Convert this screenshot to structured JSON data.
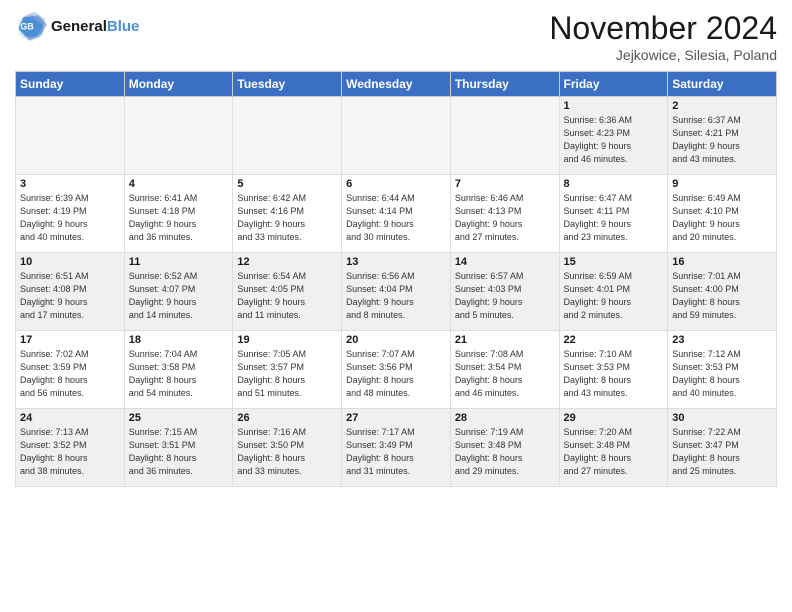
{
  "header": {
    "logo_line1": "General",
    "logo_line2": "Blue",
    "title": "November 2024",
    "location": "Jejkowice, Silesia, Poland"
  },
  "days_of_week": [
    "Sunday",
    "Monday",
    "Tuesday",
    "Wednesday",
    "Thursday",
    "Friday",
    "Saturday"
  ],
  "weeks": [
    [
      {
        "day": "",
        "info": ""
      },
      {
        "day": "",
        "info": ""
      },
      {
        "day": "",
        "info": ""
      },
      {
        "day": "",
        "info": ""
      },
      {
        "day": "",
        "info": ""
      },
      {
        "day": "1",
        "info": "Sunrise: 6:36 AM\nSunset: 4:23 PM\nDaylight: 9 hours\nand 46 minutes."
      },
      {
        "day": "2",
        "info": "Sunrise: 6:37 AM\nSunset: 4:21 PM\nDaylight: 9 hours\nand 43 minutes."
      }
    ],
    [
      {
        "day": "3",
        "info": "Sunrise: 6:39 AM\nSunset: 4:19 PM\nDaylight: 9 hours\nand 40 minutes."
      },
      {
        "day": "4",
        "info": "Sunrise: 6:41 AM\nSunset: 4:18 PM\nDaylight: 9 hours\nand 36 minutes."
      },
      {
        "day": "5",
        "info": "Sunrise: 6:42 AM\nSunset: 4:16 PM\nDaylight: 9 hours\nand 33 minutes."
      },
      {
        "day": "6",
        "info": "Sunrise: 6:44 AM\nSunset: 4:14 PM\nDaylight: 9 hours\nand 30 minutes."
      },
      {
        "day": "7",
        "info": "Sunrise: 6:46 AM\nSunset: 4:13 PM\nDaylight: 9 hours\nand 27 minutes."
      },
      {
        "day": "8",
        "info": "Sunrise: 6:47 AM\nSunset: 4:11 PM\nDaylight: 9 hours\nand 23 minutes."
      },
      {
        "day": "9",
        "info": "Sunrise: 6:49 AM\nSunset: 4:10 PM\nDaylight: 9 hours\nand 20 minutes."
      }
    ],
    [
      {
        "day": "10",
        "info": "Sunrise: 6:51 AM\nSunset: 4:08 PM\nDaylight: 9 hours\nand 17 minutes."
      },
      {
        "day": "11",
        "info": "Sunrise: 6:52 AM\nSunset: 4:07 PM\nDaylight: 9 hours\nand 14 minutes."
      },
      {
        "day": "12",
        "info": "Sunrise: 6:54 AM\nSunset: 4:05 PM\nDaylight: 9 hours\nand 11 minutes."
      },
      {
        "day": "13",
        "info": "Sunrise: 6:56 AM\nSunset: 4:04 PM\nDaylight: 9 hours\nand 8 minutes."
      },
      {
        "day": "14",
        "info": "Sunrise: 6:57 AM\nSunset: 4:03 PM\nDaylight: 9 hours\nand 5 minutes."
      },
      {
        "day": "15",
        "info": "Sunrise: 6:59 AM\nSunset: 4:01 PM\nDaylight: 9 hours\nand 2 minutes."
      },
      {
        "day": "16",
        "info": "Sunrise: 7:01 AM\nSunset: 4:00 PM\nDaylight: 8 hours\nand 59 minutes."
      }
    ],
    [
      {
        "day": "17",
        "info": "Sunrise: 7:02 AM\nSunset: 3:59 PM\nDaylight: 8 hours\nand 56 minutes."
      },
      {
        "day": "18",
        "info": "Sunrise: 7:04 AM\nSunset: 3:58 PM\nDaylight: 8 hours\nand 54 minutes."
      },
      {
        "day": "19",
        "info": "Sunrise: 7:05 AM\nSunset: 3:57 PM\nDaylight: 8 hours\nand 51 minutes."
      },
      {
        "day": "20",
        "info": "Sunrise: 7:07 AM\nSunset: 3:56 PM\nDaylight: 8 hours\nand 48 minutes."
      },
      {
        "day": "21",
        "info": "Sunrise: 7:08 AM\nSunset: 3:54 PM\nDaylight: 8 hours\nand 46 minutes."
      },
      {
        "day": "22",
        "info": "Sunrise: 7:10 AM\nSunset: 3:53 PM\nDaylight: 8 hours\nand 43 minutes."
      },
      {
        "day": "23",
        "info": "Sunrise: 7:12 AM\nSunset: 3:53 PM\nDaylight: 8 hours\nand 40 minutes."
      }
    ],
    [
      {
        "day": "24",
        "info": "Sunrise: 7:13 AM\nSunset: 3:52 PM\nDaylight: 8 hours\nand 38 minutes."
      },
      {
        "day": "25",
        "info": "Sunrise: 7:15 AM\nSunset: 3:51 PM\nDaylight: 8 hours\nand 36 minutes."
      },
      {
        "day": "26",
        "info": "Sunrise: 7:16 AM\nSunset: 3:50 PM\nDaylight: 8 hours\nand 33 minutes."
      },
      {
        "day": "27",
        "info": "Sunrise: 7:17 AM\nSunset: 3:49 PM\nDaylight: 8 hours\nand 31 minutes."
      },
      {
        "day": "28",
        "info": "Sunrise: 7:19 AM\nSunset: 3:48 PM\nDaylight: 8 hours\nand 29 minutes."
      },
      {
        "day": "29",
        "info": "Sunrise: 7:20 AM\nSunset: 3:48 PM\nDaylight: 8 hours\nand 27 minutes."
      },
      {
        "day": "30",
        "info": "Sunrise: 7:22 AM\nSunset: 3:47 PM\nDaylight: 8 hours\nand 25 minutes."
      }
    ]
  ]
}
